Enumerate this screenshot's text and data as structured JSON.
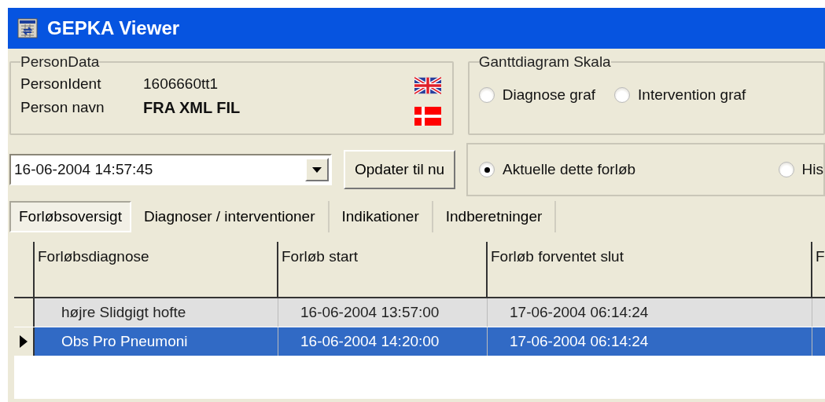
{
  "window": {
    "title": "GEPKA Viewer"
  },
  "person_data": {
    "title": "PersonData",
    "rows": [
      {
        "label": "PersonIdent",
        "value": "1606660tt1",
        "bold": false
      },
      {
        "label": "Person navn",
        "value": "FRA XML FIL",
        "bold": true
      }
    ]
  },
  "gantt_scale": {
    "title": "Ganttdiagram Skala",
    "options": [
      {
        "label": "Diagnose graf",
        "selected": false
      },
      {
        "label": "Intervention graf",
        "selected": false
      }
    ]
  },
  "date_combo": {
    "value": "16-06-2004 14:57:45"
  },
  "update_button": {
    "label": "Opdater til nu"
  },
  "view_options": [
    {
      "label": "Aktuelle dette forløb",
      "selected": true
    },
    {
      "label": "His",
      "selected": false
    }
  ],
  "tabs": [
    {
      "label": "Forløbsoversigt",
      "selected": true
    },
    {
      "label": "Diagnoser / interventioner",
      "selected": false
    },
    {
      "label": "Indikationer",
      "selected": false
    },
    {
      "label": "Indberetninger",
      "selected": false
    }
  ],
  "table": {
    "columns": [
      "Forløbsdiagnose",
      "Forløb start",
      "Forløb forventet slut",
      "F"
    ],
    "rows": [
      {
        "cells": [
          "højre Slidgigt hofte",
          "16-06-2004 13:57:00",
          "17-06-2004 06:14:24"
        ],
        "selected": false
      },
      {
        "cells": [
          "Obs Pro Pneumoni",
          "16-06-2004 14:20:00",
          "17-06-2004 06:14:24"
        ],
        "selected": true
      }
    ]
  }
}
